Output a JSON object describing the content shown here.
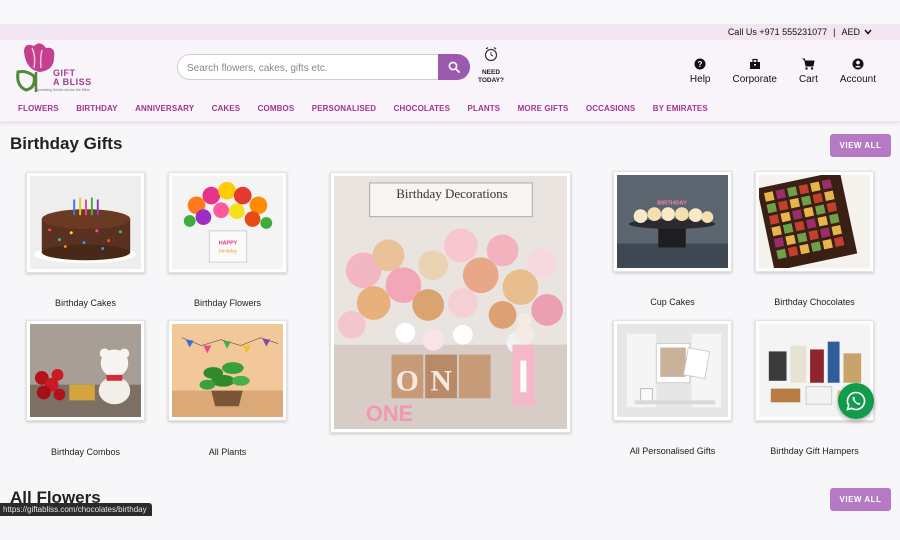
{
  "topbar": {
    "call": "Call Us +971 555231077",
    "separator": "|",
    "currency": "AED"
  },
  "logo": {
    "line1": "GIFT",
    "line2": "A BLISS",
    "tagline": "Spreading Smiles Across the Miles"
  },
  "search": {
    "placeholder": "Search flowers, cakes, gifts etc."
  },
  "need_today": {
    "line1": "NEED",
    "line2": "TODAY?"
  },
  "header_icons": [
    {
      "label": "Help",
      "icon": "help-icon"
    },
    {
      "label": "Corporate",
      "icon": "briefcase-icon"
    },
    {
      "label": "Cart",
      "icon": "cart-icon"
    },
    {
      "label": "Account",
      "icon": "account-icon"
    }
  ],
  "nav": [
    "FLOWERS",
    "BIRTHDAY",
    "ANNIVERSARY",
    "CAKES",
    "COMBOS",
    "PERSONALISED",
    "CHOCOLATES",
    "PLANTS",
    "MORE GIFTS",
    "OCCASIONS",
    "BY EMIRATES"
  ],
  "section1": {
    "title": "Birthday Gifts",
    "view_all": "VIEW ALL"
  },
  "products": [
    {
      "caption": "Birthday Cakes"
    },
    {
      "caption": "Birthday Flowers"
    },
    {
      "caption": "Cup Cakes"
    },
    {
      "caption": "Birthday Chocolates"
    },
    {
      "caption": "Birthday Combos"
    },
    {
      "caption": "All Plants"
    },
    {
      "caption": "All Personalised Gifts"
    },
    {
      "caption": "Birthday Gift Hampers"
    }
  ],
  "banner": {
    "title": "Birthday Decorations",
    "letters": "ONE",
    "number": "1",
    "floor_word": "ONE",
    "tag": "HAPPY BIRTHDAY"
  },
  "section2": {
    "title": "All Flowers",
    "view_all": "VIEW ALL"
  },
  "status_url": "https://giftabliss.com/chocolates/birthday",
  "colors": {
    "accent": "#9b5aae",
    "nav_text": "#a0368f",
    "view_all_bg": "#b57ac3",
    "whatsapp": "#129a4d"
  }
}
